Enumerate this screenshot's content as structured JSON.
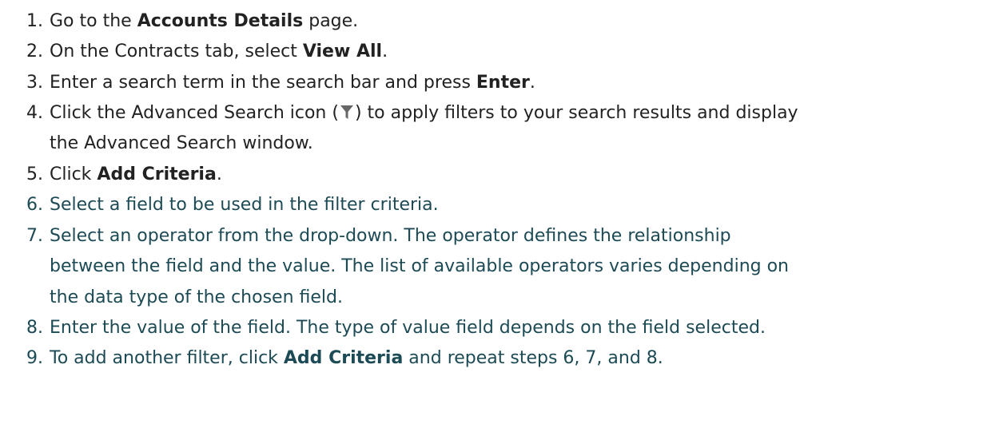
{
  "steps": [
    {
      "number": "1.",
      "parts": [
        "Go to the ",
        "Accounts Details",
        " page."
      ]
    },
    {
      "number": "2.",
      "parts": [
        "On the Contracts tab, select ",
        "View All",
        "."
      ]
    },
    {
      "number": "3.",
      "parts": [
        "Enter a search term in the search bar and press ",
        "Enter",
        "."
      ]
    },
    {
      "number": "4.",
      "parts": [
        "Click the Advanced Search icon (",
        ") to apply filters to your search results and display",
        "the Advanced Search window."
      ],
      "icon": "filter-icon"
    },
    {
      "number": "5.",
      "parts": [
        "Click ",
        "Add Criteria",
        "."
      ]
    },
    {
      "number": "6.",
      "parts": [
        "Select a field to be used in the filter criteria."
      ]
    },
    {
      "number": "7.",
      "lines": [
        "Select an operator from the drop-down. The operator defines the relationship",
        "between the field and the value. The list of available operators varies depending on",
        "the data type of the chosen field."
      ]
    },
    {
      "number": "8.",
      "parts": [
        "Enter the value of the field. The type of value field depends on the field selected."
      ]
    },
    {
      "number": "9.",
      "parts": [
        "To add another filter, click ",
        "Add Criteria",
        " and repeat steps 6, 7, and 8."
      ]
    }
  ],
  "colors": {
    "text": "#222222",
    "teal_text": "#1c4a55",
    "icon": "#666666"
  }
}
